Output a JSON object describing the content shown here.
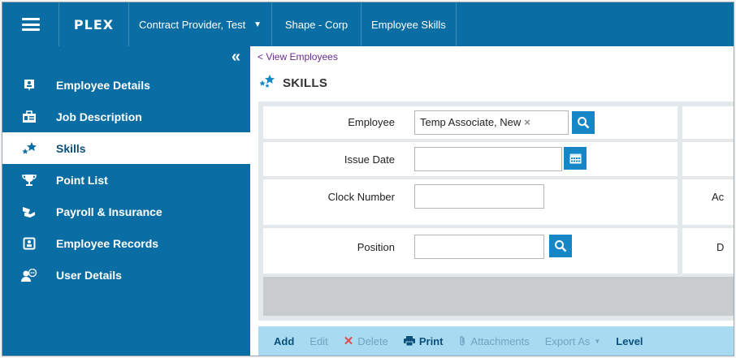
{
  "topbar": {
    "logo": "PLEX",
    "provider": "Contract Provider, Test",
    "company": "Shape - Corp",
    "screen": "Employee Skills"
  },
  "sidebar": {
    "collapse_label": "«",
    "items": [
      {
        "label": "Employee Details",
        "icon": "id-badge-icon"
      },
      {
        "label": "Job Description",
        "icon": "briefcase-icon"
      },
      {
        "label": "Skills",
        "icon": "stars-icon"
      },
      {
        "label": "Point List",
        "icon": "trophy-icon"
      },
      {
        "label": "Payroll & Insurance",
        "icon": "money-hand-icon"
      },
      {
        "label": "Employee Records",
        "icon": "record-icon"
      },
      {
        "label": "User Details",
        "icon": "user-chat-icon"
      }
    ],
    "active_index": 2
  },
  "main": {
    "back_link": "< View Employees",
    "title": "SKILLS",
    "form": {
      "employee_label": "Employee",
      "employee_value": "Temp Associate, New",
      "issue_date_label": "Issue Date",
      "issue_date_value": "",
      "clock_number_label": "Clock Number",
      "clock_number_value": "",
      "position_label": "Position",
      "position_value": "",
      "side_cut_1": "Ac",
      "side_cut_2": "D"
    },
    "toolbar": {
      "add": "Add",
      "edit": "Edit",
      "delete": "Delete",
      "print": "Print",
      "attachments": "Attachments",
      "export_as": "Export As",
      "level": "Level"
    }
  },
  "colors": {
    "brand": "#0a6ea4",
    "accent_button": "#1587c6",
    "toolbar_bg": "#a8dbf2",
    "link": "#6a2a8f"
  }
}
